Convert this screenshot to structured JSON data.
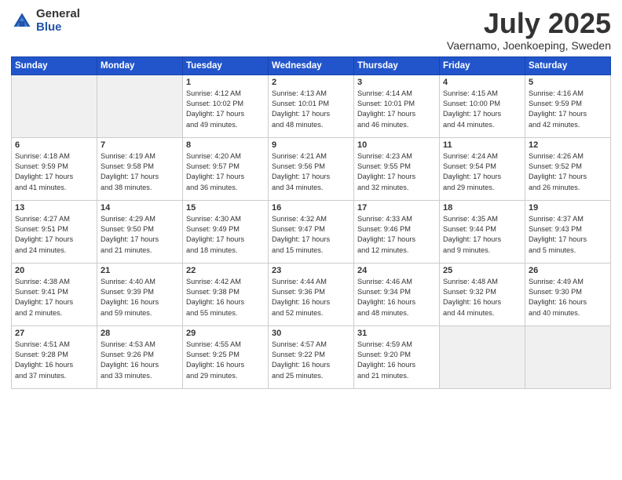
{
  "header": {
    "logo_general": "General",
    "logo_blue": "Blue",
    "month_title": "July 2025",
    "location": "Vaernamo, Joenkoeping, Sweden"
  },
  "weekdays": [
    "Sunday",
    "Monday",
    "Tuesday",
    "Wednesday",
    "Thursday",
    "Friday",
    "Saturday"
  ],
  "weeks": [
    [
      {
        "day": "",
        "empty": true
      },
      {
        "day": "",
        "empty": true
      },
      {
        "day": "1",
        "line1": "Sunrise: 4:12 AM",
        "line2": "Sunset: 10:02 PM",
        "line3": "Daylight: 17 hours",
        "line4": "and 49 minutes."
      },
      {
        "day": "2",
        "line1": "Sunrise: 4:13 AM",
        "line2": "Sunset: 10:01 PM",
        "line3": "Daylight: 17 hours",
        "line4": "and 48 minutes."
      },
      {
        "day": "3",
        "line1": "Sunrise: 4:14 AM",
        "line2": "Sunset: 10:01 PM",
        "line3": "Daylight: 17 hours",
        "line4": "and 46 minutes."
      },
      {
        "day": "4",
        "line1": "Sunrise: 4:15 AM",
        "line2": "Sunset: 10:00 PM",
        "line3": "Daylight: 17 hours",
        "line4": "and 44 minutes."
      },
      {
        "day": "5",
        "line1": "Sunrise: 4:16 AM",
        "line2": "Sunset: 9:59 PM",
        "line3": "Daylight: 17 hours",
        "line4": "and 42 minutes."
      }
    ],
    [
      {
        "day": "6",
        "line1": "Sunrise: 4:18 AM",
        "line2": "Sunset: 9:59 PM",
        "line3": "Daylight: 17 hours",
        "line4": "and 41 minutes."
      },
      {
        "day": "7",
        "line1": "Sunrise: 4:19 AM",
        "line2": "Sunset: 9:58 PM",
        "line3": "Daylight: 17 hours",
        "line4": "and 38 minutes."
      },
      {
        "day": "8",
        "line1": "Sunrise: 4:20 AM",
        "line2": "Sunset: 9:57 PM",
        "line3": "Daylight: 17 hours",
        "line4": "and 36 minutes."
      },
      {
        "day": "9",
        "line1": "Sunrise: 4:21 AM",
        "line2": "Sunset: 9:56 PM",
        "line3": "Daylight: 17 hours",
        "line4": "and 34 minutes."
      },
      {
        "day": "10",
        "line1": "Sunrise: 4:23 AM",
        "line2": "Sunset: 9:55 PM",
        "line3": "Daylight: 17 hours",
        "line4": "and 32 minutes."
      },
      {
        "day": "11",
        "line1": "Sunrise: 4:24 AM",
        "line2": "Sunset: 9:54 PM",
        "line3": "Daylight: 17 hours",
        "line4": "and 29 minutes."
      },
      {
        "day": "12",
        "line1": "Sunrise: 4:26 AM",
        "line2": "Sunset: 9:52 PM",
        "line3": "Daylight: 17 hours",
        "line4": "and 26 minutes."
      }
    ],
    [
      {
        "day": "13",
        "line1": "Sunrise: 4:27 AM",
        "line2": "Sunset: 9:51 PM",
        "line3": "Daylight: 17 hours",
        "line4": "and 24 minutes."
      },
      {
        "day": "14",
        "line1": "Sunrise: 4:29 AM",
        "line2": "Sunset: 9:50 PM",
        "line3": "Daylight: 17 hours",
        "line4": "and 21 minutes."
      },
      {
        "day": "15",
        "line1": "Sunrise: 4:30 AM",
        "line2": "Sunset: 9:49 PM",
        "line3": "Daylight: 17 hours",
        "line4": "and 18 minutes."
      },
      {
        "day": "16",
        "line1": "Sunrise: 4:32 AM",
        "line2": "Sunset: 9:47 PM",
        "line3": "Daylight: 17 hours",
        "line4": "and 15 minutes."
      },
      {
        "day": "17",
        "line1": "Sunrise: 4:33 AM",
        "line2": "Sunset: 9:46 PM",
        "line3": "Daylight: 17 hours",
        "line4": "and 12 minutes."
      },
      {
        "day": "18",
        "line1": "Sunrise: 4:35 AM",
        "line2": "Sunset: 9:44 PM",
        "line3": "Daylight: 17 hours",
        "line4": "and 9 minutes."
      },
      {
        "day": "19",
        "line1": "Sunrise: 4:37 AM",
        "line2": "Sunset: 9:43 PM",
        "line3": "Daylight: 17 hours",
        "line4": "and 5 minutes."
      }
    ],
    [
      {
        "day": "20",
        "line1": "Sunrise: 4:38 AM",
        "line2": "Sunset: 9:41 PM",
        "line3": "Daylight: 17 hours",
        "line4": "and 2 minutes."
      },
      {
        "day": "21",
        "line1": "Sunrise: 4:40 AM",
        "line2": "Sunset: 9:39 PM",
        "line3": "Daylight: 16 hours",
        "line4": "and 59 minutes."
      },
      {
        "day": "22",
        "line1": "Sunrise: 4:42 AM",
        "line2": "Sunset: 9:38 PM",
        "line3": "Daylight: 16 hours",
        "line4": "and 55 minutes."
      },
      {
        "day": "23",
        "line1": "Sunrise: 4:44 AM",
        "line2": "Sunset: 9:36 PM",
        "line3": "Daylight: 16 hours",
        "line4": "and 52 minutes."
      },
      {
        "day": "24",
        "line1": "Sunrise: 4:46 AM",
        "line2": "Sunset: 9:34 PM",
        "line3": "Daylight: 16 hours",
        "line4": "and 48 minutes."
      },
      {
        "day": "25",
        "line1": "Sunrise: 4:48 AM",
        "line2": "Sunset: 9:32 PM",
        "line3": "Daylight: 16 hours",
        "line4": "and 44 minutes."
      },
      {
        "day": "26",
        "line1": "Sunrise: 4:49 AM",
        "line2": "Sunset: 9:30 PM",
        "line3": "Daylight: 16 hours",
        "line4": "and 40 minutes."
      }
    ],
    [
      {
        "day": "27",
        "line1": "Sunrise: 4:51 AM",
        "line2": "Sunset: 9:28 PM",
        "line3": "Daylight: 16 hours",
        "line4": "and 37 minutes."
      },
      {
        "day": "28",
        "line1": "Sunrise: 4:53 AM",
        "line2": "Sunset: 9:26 PM",
        "line3": "Daylight: 16 hours",
        "line4": "and 33 minutes."
      },
      {
        "day": "29",
        "line1": "Sunrise: 4:55 AM",
        "line2": "Sunset: 9:25 PM",
        "line3": "Daylight: 16 hours",
        "line4": "and 29 minutes."
      },
      {
        "day": "30",
        "line1": "Sunrise: 4:57 AM",
        "line2": "Sunset: 9:22 PM",
        "line3": "Daylight: 16 hours",
        "line4": "and 25 minutes."
      },
      {
        "day": "31",
        "line1": "Sunrise: 4:59 AM",
        "line2": "Sunset: 9:20 PM",
        "line3": "Daylight: 16 hours",
        "line4": "and 21 minutes."
      },
      {
        "day": "",
        "empty": true
      },
      {
        "day": "",
        "empty": true
      }
    ]
  ]
}
